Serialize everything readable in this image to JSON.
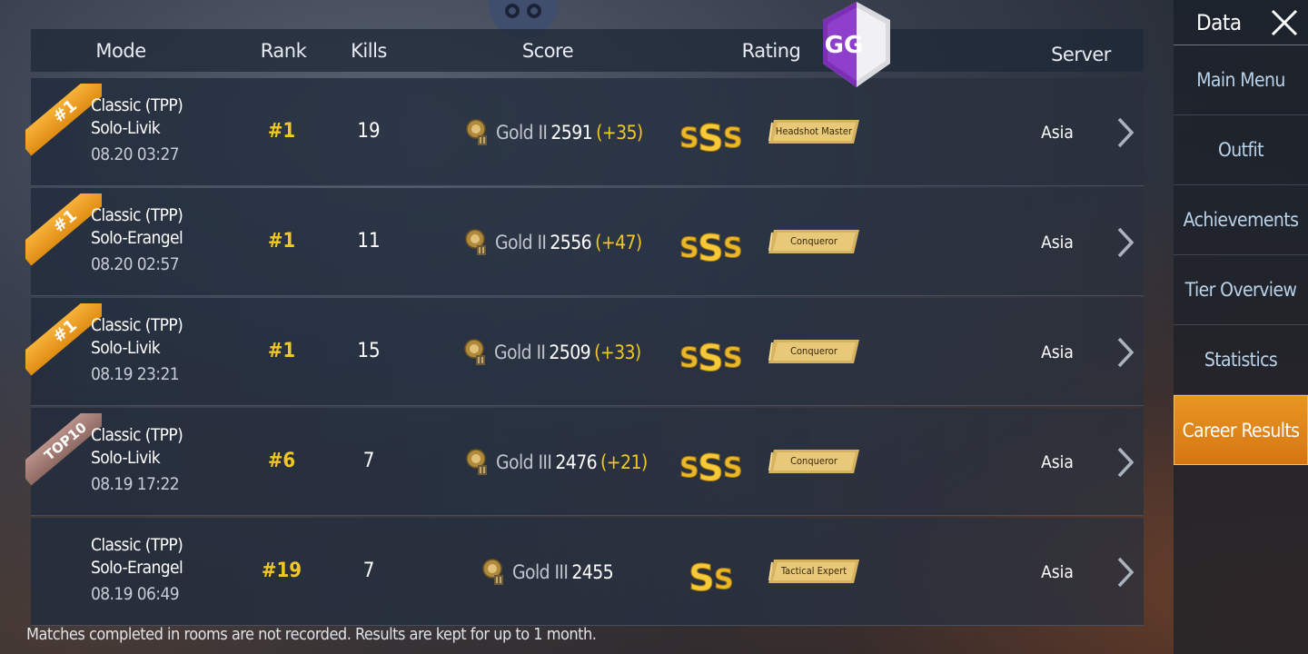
{
  "header": {
    "mode": "Mode",
    "rank": "Rank",
    "kills": "Kills",
    "score": "Score",
    "rating": "Rating",
    "server": "Server"
  },
  "matches": [
    {
      "ribbon": "#1",
      "ribbon_type": "gold",
      "mode_line1": "Classic (TPP)",
      "mode_line2": "Solo-Livik",
      "datetime": "08.20 03:27",
      "rank": "#1",
      "kills": "19",
      "tier": "Gold II",
      "score": "2591",
      "delta": "(+35)",
      "grade": "SSS",
      "title": "Headshot Master",
      "server": "Asia"
    },
    {
      "ribbon": "#1",
      "ribbon_type": "gold",
      "mode_line1": "Classic (TPP)",
      "mode_line2": "Solo-Erangel",
      "datetime": "08.20 02:57",
      "rank": "#1",
      "kills": "11",
      "tier": "Gold II",
      "score": "2556",
      "delta": "(+47)",
      "grade": "SSS",
      "title": "Conqueror",
      "server": "Asia"
    },
    {
      "ribbon": "#1",
      "ribbon_type": "gold",
      "mode_line1": "Classic (TPP)",
      "mode_line2": "Solo-Livik",
      "datetime": "08.19 23:21",
      "rank": "#1",
      "kills": "15",
      "tier": "Gold II",
      "score": "2509",
      "delta": "(+33)",
      "grade": "SSS",
      "title": "Conqueror",
      "server": "Asia"
    },
    {
      "ribbon": "TOP10",
      "ribbon_type": "top10",
      "mode_line1": "Classic (TPP)",
      "mode_line2": "Solo-Livik",
      "datetime": "08.19 17:22",
      "rank": "#6",
      "kills": "7",
      "tier": "Gold III",
      "score": "2476",
      "delta": "(+21)",
      "grade": "SSS",
      "title": "Conqueror",
      "server": "Asia"
    },
    {
      "ribbon": "",
      "ribbon_type": "none",
      "mode_line1": "Classic (TPP)",
      "mode_line2": "Solo-Erangel",
      "datetime": "08.19 06:49",
      "rank": "#19",
      "kills": "7",
      "tier": "Gold III",
      "score": "2455",
      "delta": "",
      "grade": "SS",
      "title": "Tactical Expert",
      "server": "Asia"
    }
  ],
  "footer": "Matches completed in rooms are not recorded. Results are kept for up to 1 month.",
  "sidebar": {
    "title": "Data",
    "close_icon": "close-icon",
    "items": [
      {
        "label": "Main Menu",
        "active": false
      },
      {
        "label": "Outfit",
        "active": false
      },
      {
        "label": "Achievements",
        "active": false
      },
      {
        "label": "Tier Overview",
        "active": false
      },
      {
        "label": "Statistics",
        "active": false
      },
      {
        "label": "Career Results",
        "active": true
      }
    ]
  },
  "overlay": {
    "gg_logo": "GG"
  },
  "colors": {
    "accent_gold": "#f0c823",
    "active_tab": "#e08c1a",
    "ribbon_gold": "#f0a22a",
    "ribbon_top10": "#a27d76",
    "sidebar_text": "#b9d3ea"
  }
}
